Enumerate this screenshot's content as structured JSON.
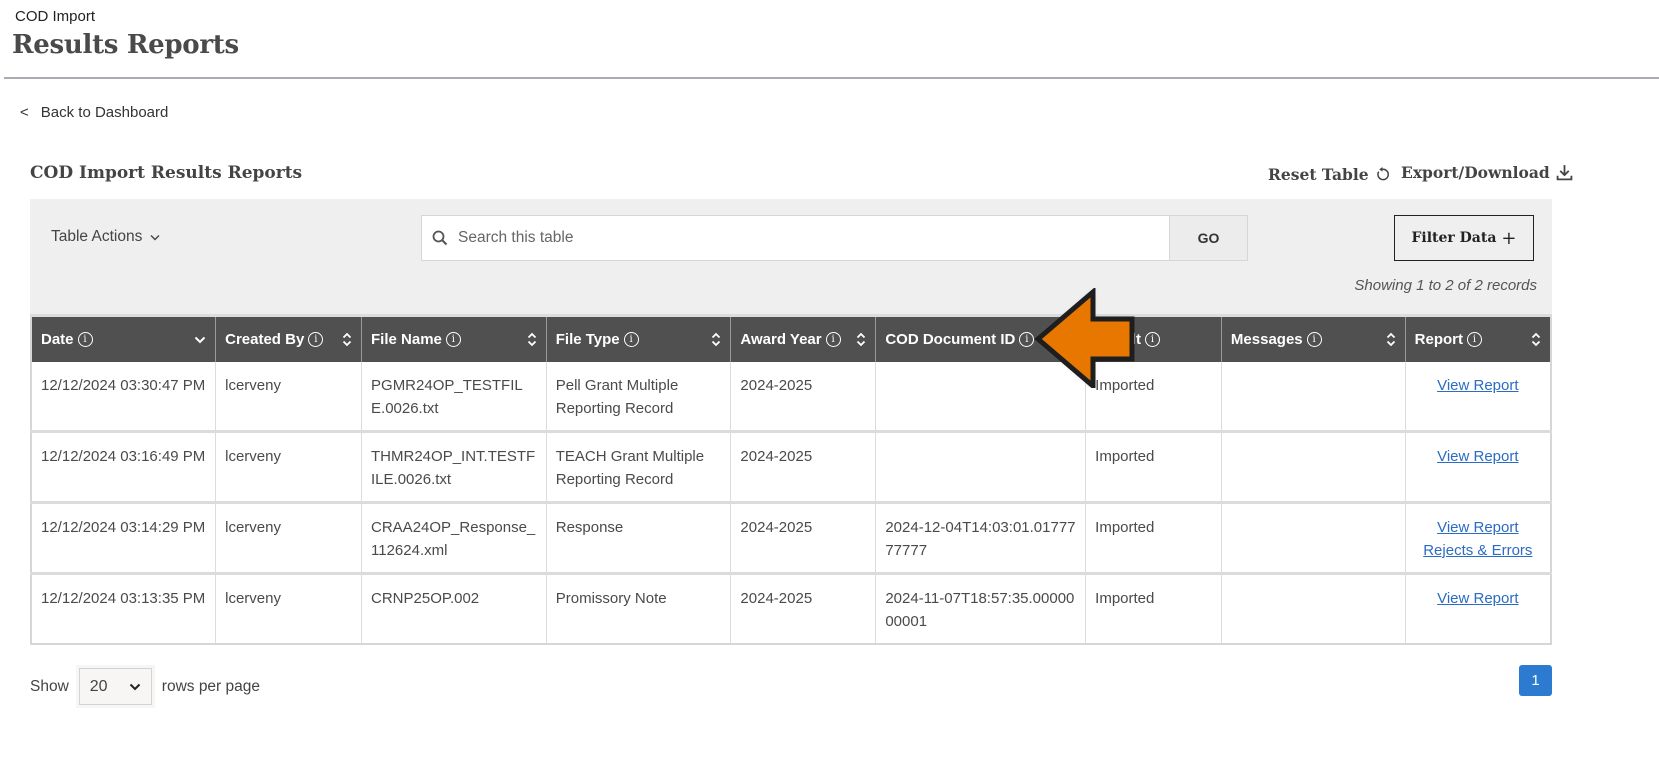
{
  "header": {
    "breadcrumb": "COD Import",
    "title": "Results Reports",
    "back_link": "Back to Dashboard",
    "back_icon": "<"
  },
  "section": {
    "title": "COD Import Results Reports",
    "reset_label": "Reset Table",
    "export_label": "Export/Download"
  },
  "toolbar": {
    "table_actions_label": "Table Actions",
    "search_placeholder": "Search this table",
    "search_value": "",
    "go_label": "GO",
    "filter_label": "Filter Data",
    "showing_text": "Showing 1 to 2 of 2 records"
  },
  "table": {
    "columns": [
      {
        "label": "Date",
        "sort": "desc"
      },
      {
        "label": "Created By",
        "sort": "both"
      },
      {
        "label": "File Name",
        "sort": "both"
      },
      {
        "label": "File Type",
        "sort": "both"
      },
      {
        "label": "Award Year",
        "sort": "both"
      },
      {
        "label": "COD Document ID",
        "sort": "none"
      },
      {
        "label": "Result",
        "sort": "none"
      },
      {
        "label": "Messages",
        "sort": "both"
      },
      {
        "label": "Report",
        "sort": "both"
      }
    ],
    "rows": [
      {
        "date": "12/12/2024 03:30:47 PM",
        "created_by": "lcerveny",
        "file_name": "PGMR24OP_TESTFILE.0026.txt",
        "file_type": "Pell Grant Multiple Reporting Record",
        "award_year": "2024-2025",
        "cod_document_id": "",
        "result": "Imported",
        "messages": "",
        "report_links": [
          "View Report"
        ]
      },
      {
        "date": "12/12/2024 03:16:49 PM",
        "created_by": "lcerveny",
        "file_name": "THMR24OP_INT.TESTFILE.0026.txt",
        "file_type": "TEACH Grant Multiple Reporting Record",
        "award_year": "2024-2025",
        "cod_document_id": "",
        "result": "Imported",
        "messages": "",
        "report_links": [
          "View Report"
        ]
      },
      {
        "date": "12/12/2024 03:14:29 PM",
        "created_by": "lcerveny",
        "file_name": "CRAA24OP_Response_112624.xml",
        "file_type": "Response",
        "award_year": "2024-2025",
        "cod_document_id": "2024-12-04T14:03:01.0177777777",
        "result": "Imported",
        "messages": "",
        "report_links": [
          "View Report",
          "Rejects & Errors"
        ]
      },
      {
        "date": "12/12/2024 03:13:35 PM",
        "created_by": "lcerveny",
        "file_name": "CRNP25OP.002",
        "file_type": "Promissory Note",
        "award_year": "2024-2025",
        "cod_document_id": "2024-11-07T18:57:35.0000000001",
        "result": "Imported",
        "messages": "",
        "report_links": [
          "View Report"
        ]
      }
    ]
  },
  "footer": {
    "show_label": "Show",
    "rows_per_page_value": "20",
    "rows_per_page_label": "rows per page",
    "current_page": "1"
  },
  "colors": {
    "header_bg": "#505050",
    "link": "#2a6cc4",
    "page_active": "#2c7bd0",
    "annotation_arrow": "#e87700"
  }
}
